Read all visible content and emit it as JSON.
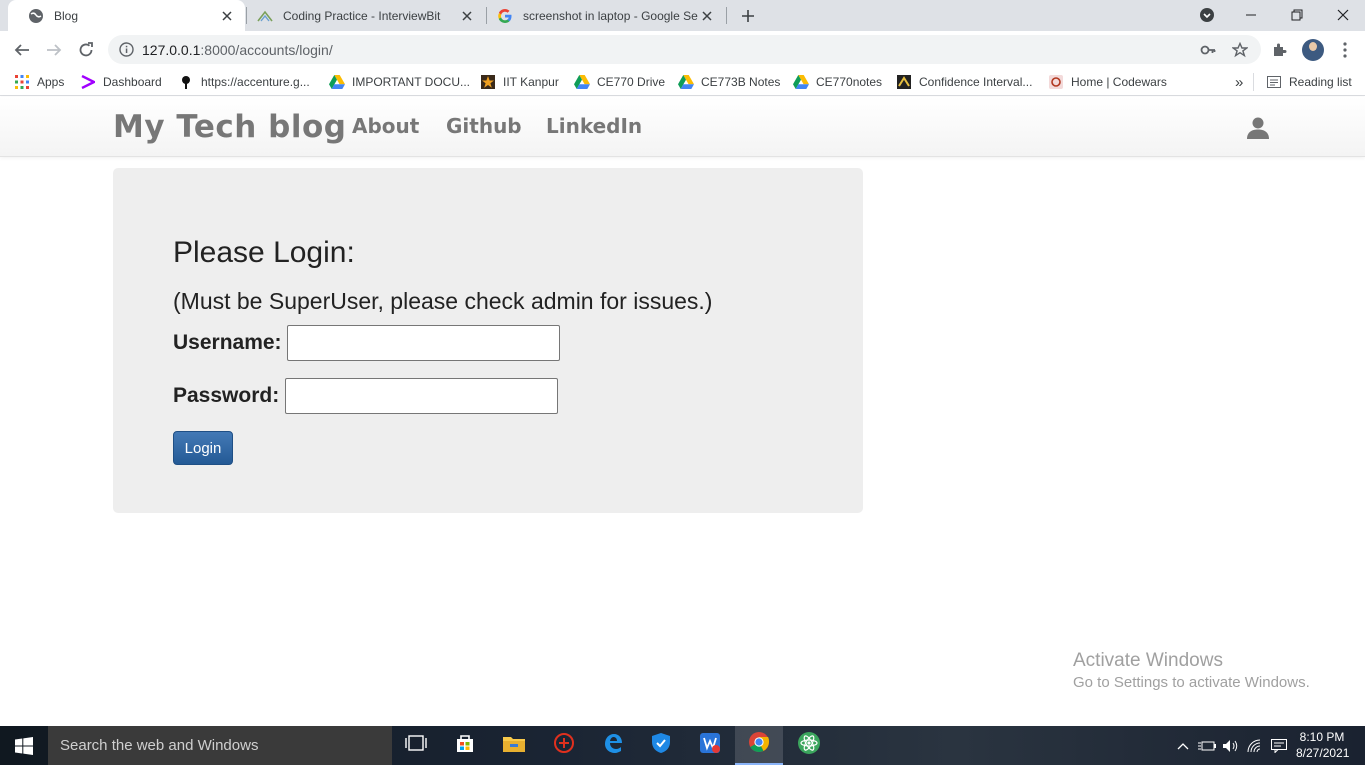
{
  "browser": {
    "tabs": [
      {
        "title": "Blog",
        "favicon": "globe-icon",
        "active": true
      },
      {
        "title": "Coding Practice - InterviewBit",
        "favicon": "interviewbit-icon",
        "active": false
      },
      {
        "title": "screenshot in laptop - Google Se",
        "favicon": "google-icon",
        "active": false
      }
    ],
    "url_host": "127.0.0.1",
    "url_path": ":8000/accounts/login/",
    "bookmarks": [
      {
        "label": "Apps",
        "icon": "apps-grid-icon"
      },
      {
        "label": "Dashboard",
        "icon": "accenture-icon"
      },
      {
        "label": "https://accenture.g...",
        "icon": "pin-icon"
      },
      {
        "label": "IMPORTANT DOCU...",
        "icon": "drive-icon"
      },
      {
        "label": "IIT Kanpur",
        "icon": "iitk-icon"
      },
      {
        "label": "CE770 Drive",
        "icon": "drive-icon"
      },
      {
        "label": "CE773B Notes",
        "icon": "drive-icon"
      },
      {
        "label": "CE770notes",
        "icon": "drive-icon"
      },
      {
        "label": "Confidence Interval...",
        "icon": "site-icon"
      },
      {
        "label": "Home | Codewars",
        "icon": "codewars-icon"
      }
    ],
    "more_bookmarks": "»",
    "reading_list": "Reading list"
  },
  "site": {
    "brand": "My Tech blog",
    "nav": [
      "About",
      "Github",
      "LinkedIn"
    ],
    "user_icon": "user-icon"
  },
  "login": {
    "heading": "Please Login:",
    "note": "(Must be SuperUser, please check admin for issues.)",
    "username_label": "Username:",
    "password_label": "Password:",
    "username_value": "",
    "password_value": "",
    "button": "Login"
  },
  "watermark": {
    "line1": "Activate Windows",
    "line2": "Go to Settings to activate Windows."
  },
  "taskbar": {
    "search_placeholder": "Search the web and Windows",
    "time": "8:10 PM",
    "date": "8/27/2021"
  },
  "colors": {
    "accent_button": "#245a95",
    "panel": "#eeeeee",
    "brand_text": "#777777"
  }
}
